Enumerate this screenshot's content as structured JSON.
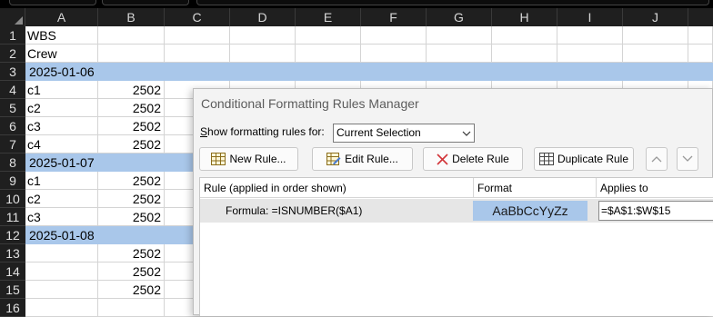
{
  "sheet": {
    "columns": [
      "A",
      "B",
      "C",
      "D",
      "E",
      "F",
      "G",
      "H",
      "I",
      "J"
    ],
    "rows": [
      {
        "n": "1",
        "a": "WBS",
        "b": "",
        "band": false
      },
      {
        "n": "2",
        "a": "Crew",
        "b": "",
        "band": false
      },
      {
        "n": "3",
        "a": "2025-01-06",
        "b": "",
        "band": true
      },
      {
        "n": "4",
        "a": "c1",
        "b": "2502",
        "band": false
      },
      {
        "n": "5",
        "a": "c2",
        "b": "2502",
        "band": false
      },
      {
        "n": "6",
        "a": "c3",
        "b": "2502",
        "band": false
      },
      {
        "n": "7",
        "a": "c4",
        "b": "2502",
        "band": false
      },
      {
        "n": "8",
        "a": "2025-01-07",
        "b": "",
        "band": true
      },
      {
        "n": "9",
        "a": "c1",
        "b": "2502",
        "band": false
      },
      {
        "n": "10",
        "a": "c2",
        "b": "2502",
        "band": false
      },
      {
        "n": "11",
        "a": "c3",
        "b": "2502",
        "band": false
      },
      {
        "n": "12",
        "a": "2025-01-08",
        "b": "",
        "band": true
      },
      {
        "n": "13",
        "a": "",
        "b": "2502",
        "band": false
      },
      {
        "n": "14",
        "a": "",
        "b": "2502",
        "band": false
      },
      {
        "n": "15",
        "a": "",
        "b": "2502",
        "band": false
      },
      {
        "n": "16",
        "a": "",
        "b": "",
        "band": false
      }
    ],
    "band_color": "#a9c7ea"
  },
  "dialog": {
    "title": "Conditional Formatting Rules Manager",
    "show_label_prefix": "S",
    "show_label_rest": "how formatting rules for:",
    "scope_value": "Current Selection",
    "buttons": {
      "new_rule": "New Rule...",
      "edit_rule": "Edit Rule...",
      "delete_rule": "Delete Rule",
      "duplicate_rule": "Duplicate Rule"
    },
    "columns": {
      "rule": "Rule (applied in order shown)",
      "format": "Format",
      "applies_to": "Applies to"
    },
    "rules": [
      {
        "rule": "Formula: =ISNUMBER($A1)",
        "format_preview": "AaBbCcYyZz",
        "applies_to": "=$A$1:$W$15"
      }
    ]
  }
}
